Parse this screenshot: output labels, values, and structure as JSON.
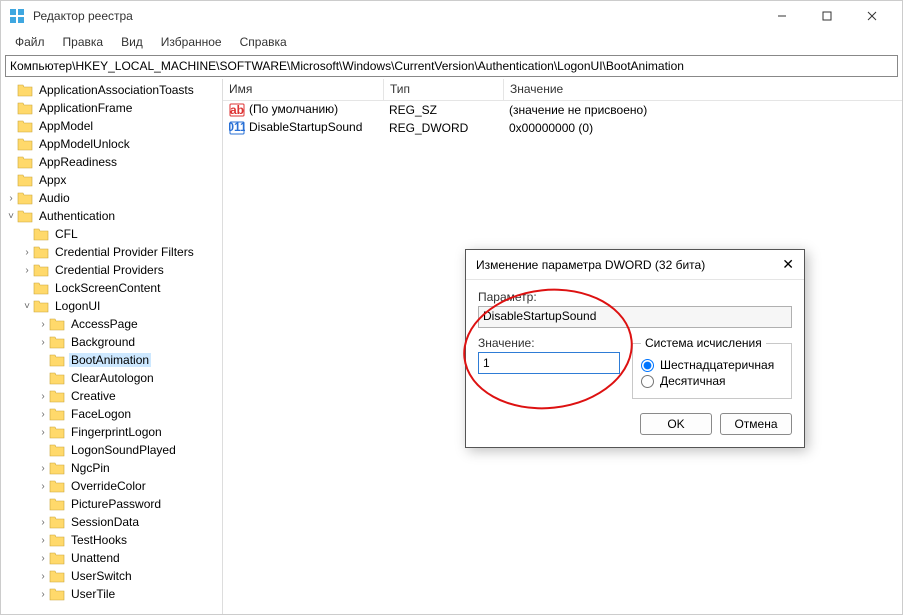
{
  "window": {
    "title": "Редактор реестра"
  },
  "menu": {
    "file": "Файл",
    "edit": "Правка",
    "view": "Вид",
    "favorites": "Избранное",
    "help": "Справка"
  },
  "address": "Компьютер\\HKEY_LOCAL_MACHINE\\SOFTWARE\\Microsoft\\Windows\\CurrentVersion\\Authentication\\LogonUI\\BootAnimation",
  "tree": [
    {
      "indent": 0,
      "twisty": "",
      "label": "ApplicationAssociationToasts",
      "hasFolder": true
    },
    {
      "indent": 0,
      "twisty": "",
      "label": "ApplicationFrame",
      "hasFolder": true
    },
    {
      "indent": 0,
      "twisty": "",
      "label": "AppModel",
      "hasFolder": true
    },
    {
      "indent": 0,
      "twisty": "",
      "label": "AppModelUnlock",
      "hasFolder": true
    },
    {
      "indent": 0,
      "twisty": "",
      "label": "AppReadiness",
      "hasFolder": true
    },
    {
      "indent": 0,
      "twisty": "",
      "label": "Appx",
      "hasFolder": true
    },
    {
      "indent": 0,
      "twisty": ">",
      "label": "Audio",
      "hasFolder": true
    },
    {
      "indent": 0,
      "twisty": "v",
      "label": "Authentication",
      "hasFolder": true
    },
    {
      "indent": 1,
      "twisty": "",
      "label": "CFL",
      "hasFolder": true
    },
    {
      "indent": 1,
      "twisty": ">",
      "label": "Credential Provider Filters",
      "hasFolder": true
    },
    {
      "indent": 1,
      "twisty": ">",
      "label": "Credential Providers",
      "hasFolder": true
    },
    {
      "indent": 1,
      "twisty": "",
      "label": "LockScreenContent",
      "hasFolder": true
    },
    {
      "indent": 1,
      "twisty": "v",
      "label": "LogonUI",
      "hasFolder": true
    },
    {
      "indent": 2,
      "twisty": ">",
      "label": "AccessPage",
      "hasFolder": true
    },
    {
      "indent": 2,
      "twisty": ">",
      "label": "Background",
      "hasFolder": true
    },
    {
      "indent": 2,
      "twisty": "",
      "label": "BootAnimation",
      "hasFolder": true,
      "selected": true
    },
    {
      "indent": 2,
      "twisty": "",
      "label": "ClearAutologon",
      "hasFolder": true
    },
    {
      "indent": 2,
      "twisty": ">",
      "label": "Creative",
      "hasFolder": true
    },
    {
      "indent": 2,
      "twisty": ">",
      "label": "FaceLogon",
      "hasFolder": true
    },
    {
      "indent": 2,
      "twisty": ">",
      "label": "FingerprintLogon",
      "hasFolder": true
    },
    {
      "indent": 2,
      "twisty": "",
      "label": "LogonSoundPlayed",
      "hasFolder": true
    },
    {
      "indent": 2,
      "twisty": ">",
      "label": "NgcPin",
      "hasFolder": true
    },
    {
      "indent": 2,
      "twisty": ">",
      "label": "OverrideColor",
      "hasFolder": true
    },
    {
      "indent": 2,
      "twisty": "",
      "label": "PicturePassword",
      "hasFolder": true
    },
    {
      "indent": 2,
      "twisty": ">",
      "label": "SessionData",
      "hasFolder": true
    },
    {
      "indent": 2,
      "twisty": ">",
      "label": "TestHooks",
      "hasFolder": true
    },
    {
      "indent": 2,
      "twisty": ">",
      "label": "Unattend",
      "hasFolder": true
    },
    {
      "indent": 2,
      "twisty": ">",
      "label": "UserSwitch",
      "hasFolder": true
    },
    {
      "indent": 2,
      "twisty": ">",
      "label": "UserTile",
      "hasFolder": true
    }
  ],
  "columns": {
    "name": "Имя",
    "type": "Тип",
    "value": "Значение"
  },
  "rows": [
    {
      "icon": "sz",
      "name": "(По умолчанию)",
      "type": "REG_SZ",
      "value": "(значение не присвоено)"
    },
    {
      "icon": "dw",
      "name": "DisableStartupSound",
      "type": "REG_DWORD",
      "value": "0x00000000 (0)"
    }
  ],
  "dialog": {
    "title": "Изменение параметра DWORD (32 бита)",
    "param_label": "Параметр:",
    "param_value": "DisableStartupSound",
    "value_label": "Значение:",
    "value_input": "1",
    "base_label": "Система исчисления",
    "radio_hex": "Шестнадцатеричная",
    "radio_dec": "Десятичная",
    "ok": "OK",
    "cancel": "Отмена"
  }
}
